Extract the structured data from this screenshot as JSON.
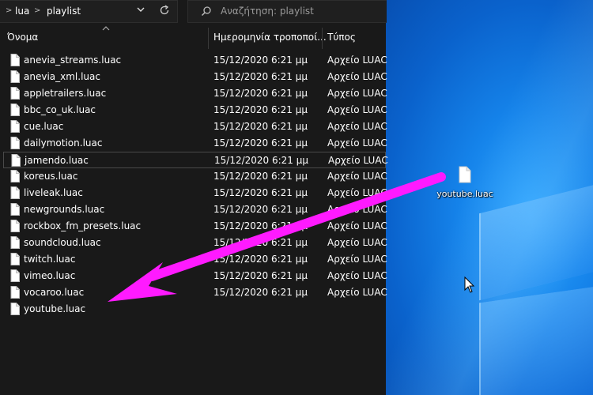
{
  "address": {
    "segments": [
      "lua",
      "playlist"
    ],
    "separator": ">",
    "dropdown_icon": "chevron-down-icon",
    "refresh_icon": "refresh-icon"
  },
  "search": {
    "placeholder": "Αναζήτηση: playlist",
    "icon": "search-icon"
  },
  "columns": {
    "name": "Όνομα",
    "date": "Ημερομηνία τροποποί...",
    "type": "Τύπος"
  },
  "files": [
    {
      "name": "anevia_streams.luac",
      "date": "15/12/2020 6:21 μμ",
      "type": "Αρχείο LUAC"
    },
    {
      "name": "anevia_xml.luac",
      "date": "15/12/2020 6:21 μμ",
      "type": "Αρχείο LUAC"
    },
    {
      "name": "appletrailers.luac",
      "date": "15/12/2020 6:21 μμ",
      "type": "Αρχείο LUAC"
    },
    {
      "name": "bbc_co_uk.luac",
      "date": "15/12/2020 6:21 μμ",
      "type": "Αρχείο LUAC"
    },
    {
      "name": "cue.luac",
      "date": "15/12/2020 6:21 μμ",
      "type": "Αρχείο LUAC"
    },
    {
      "name": "dailymotion.luac",
      "date": "15/12/2020 6:21 μμ",
      "type": "Αρχείο LUAC"
    },
    {
      "name": "jamendo.luac",
      "date": "15/12/2020 6:21 μμ",
      "type": "Αρχείο LUAC",
      "selected": true
    },
    {
      "name": "koreus.luac",
      "date": "15/12/2020 6:21 μμ",
      "type": "Αρχείο LUAC"
    },
    {
      "name": "liveleak.luac",
      "date": "15/12/2020 6:21 μμ",
      "type": "Αρχείο LUAC"
    },
    {
      "name": "newgrounds.luac",
      "date": "15/12/2020 6:21 μμ",
      "type": "Αρχείο LUAC"
    },
    {
      "name": "rockbox_fm_presets.luac",
      "date": "15/12/2020 6:21 μμ",
      "type": "Αρχείο LUAC"
    },
    {
      "name": "soundcloud.luac",
      "date": "15/12/2020 6:21 μμ",
      "type": "Αρχείο LUAC"
    },
    {
      "name": "twitch.luac",
      "date": "15/12/2020 6:21 μμ",
      "type": "Αρχείο LUAC"
    },
    {
      "name": "vimeo.luac",
      "date": "15/12/2020 6:21 μμ",
      "type": "Αρχείο LUAC"
    },
    {
      "name": "vocaroo.luac",
      "date": "15/12/2020 6:21 μμ",
      "type": "Αρχείο LUAC"
    },
    {
      "name": "youtube.luac",
      "date": "",
      "type": ""
    }
  ],
  "desktop": {
    "icon_label": "youtube.luac",
    "icon": "file-icon"
  },
  "annotation": {
    "arrow_color": "#ff1aff"
  },
  "colors": {
    "explorer_bg": "#191919",
    "desktop_blue": "#0a62cc"
  }
}
